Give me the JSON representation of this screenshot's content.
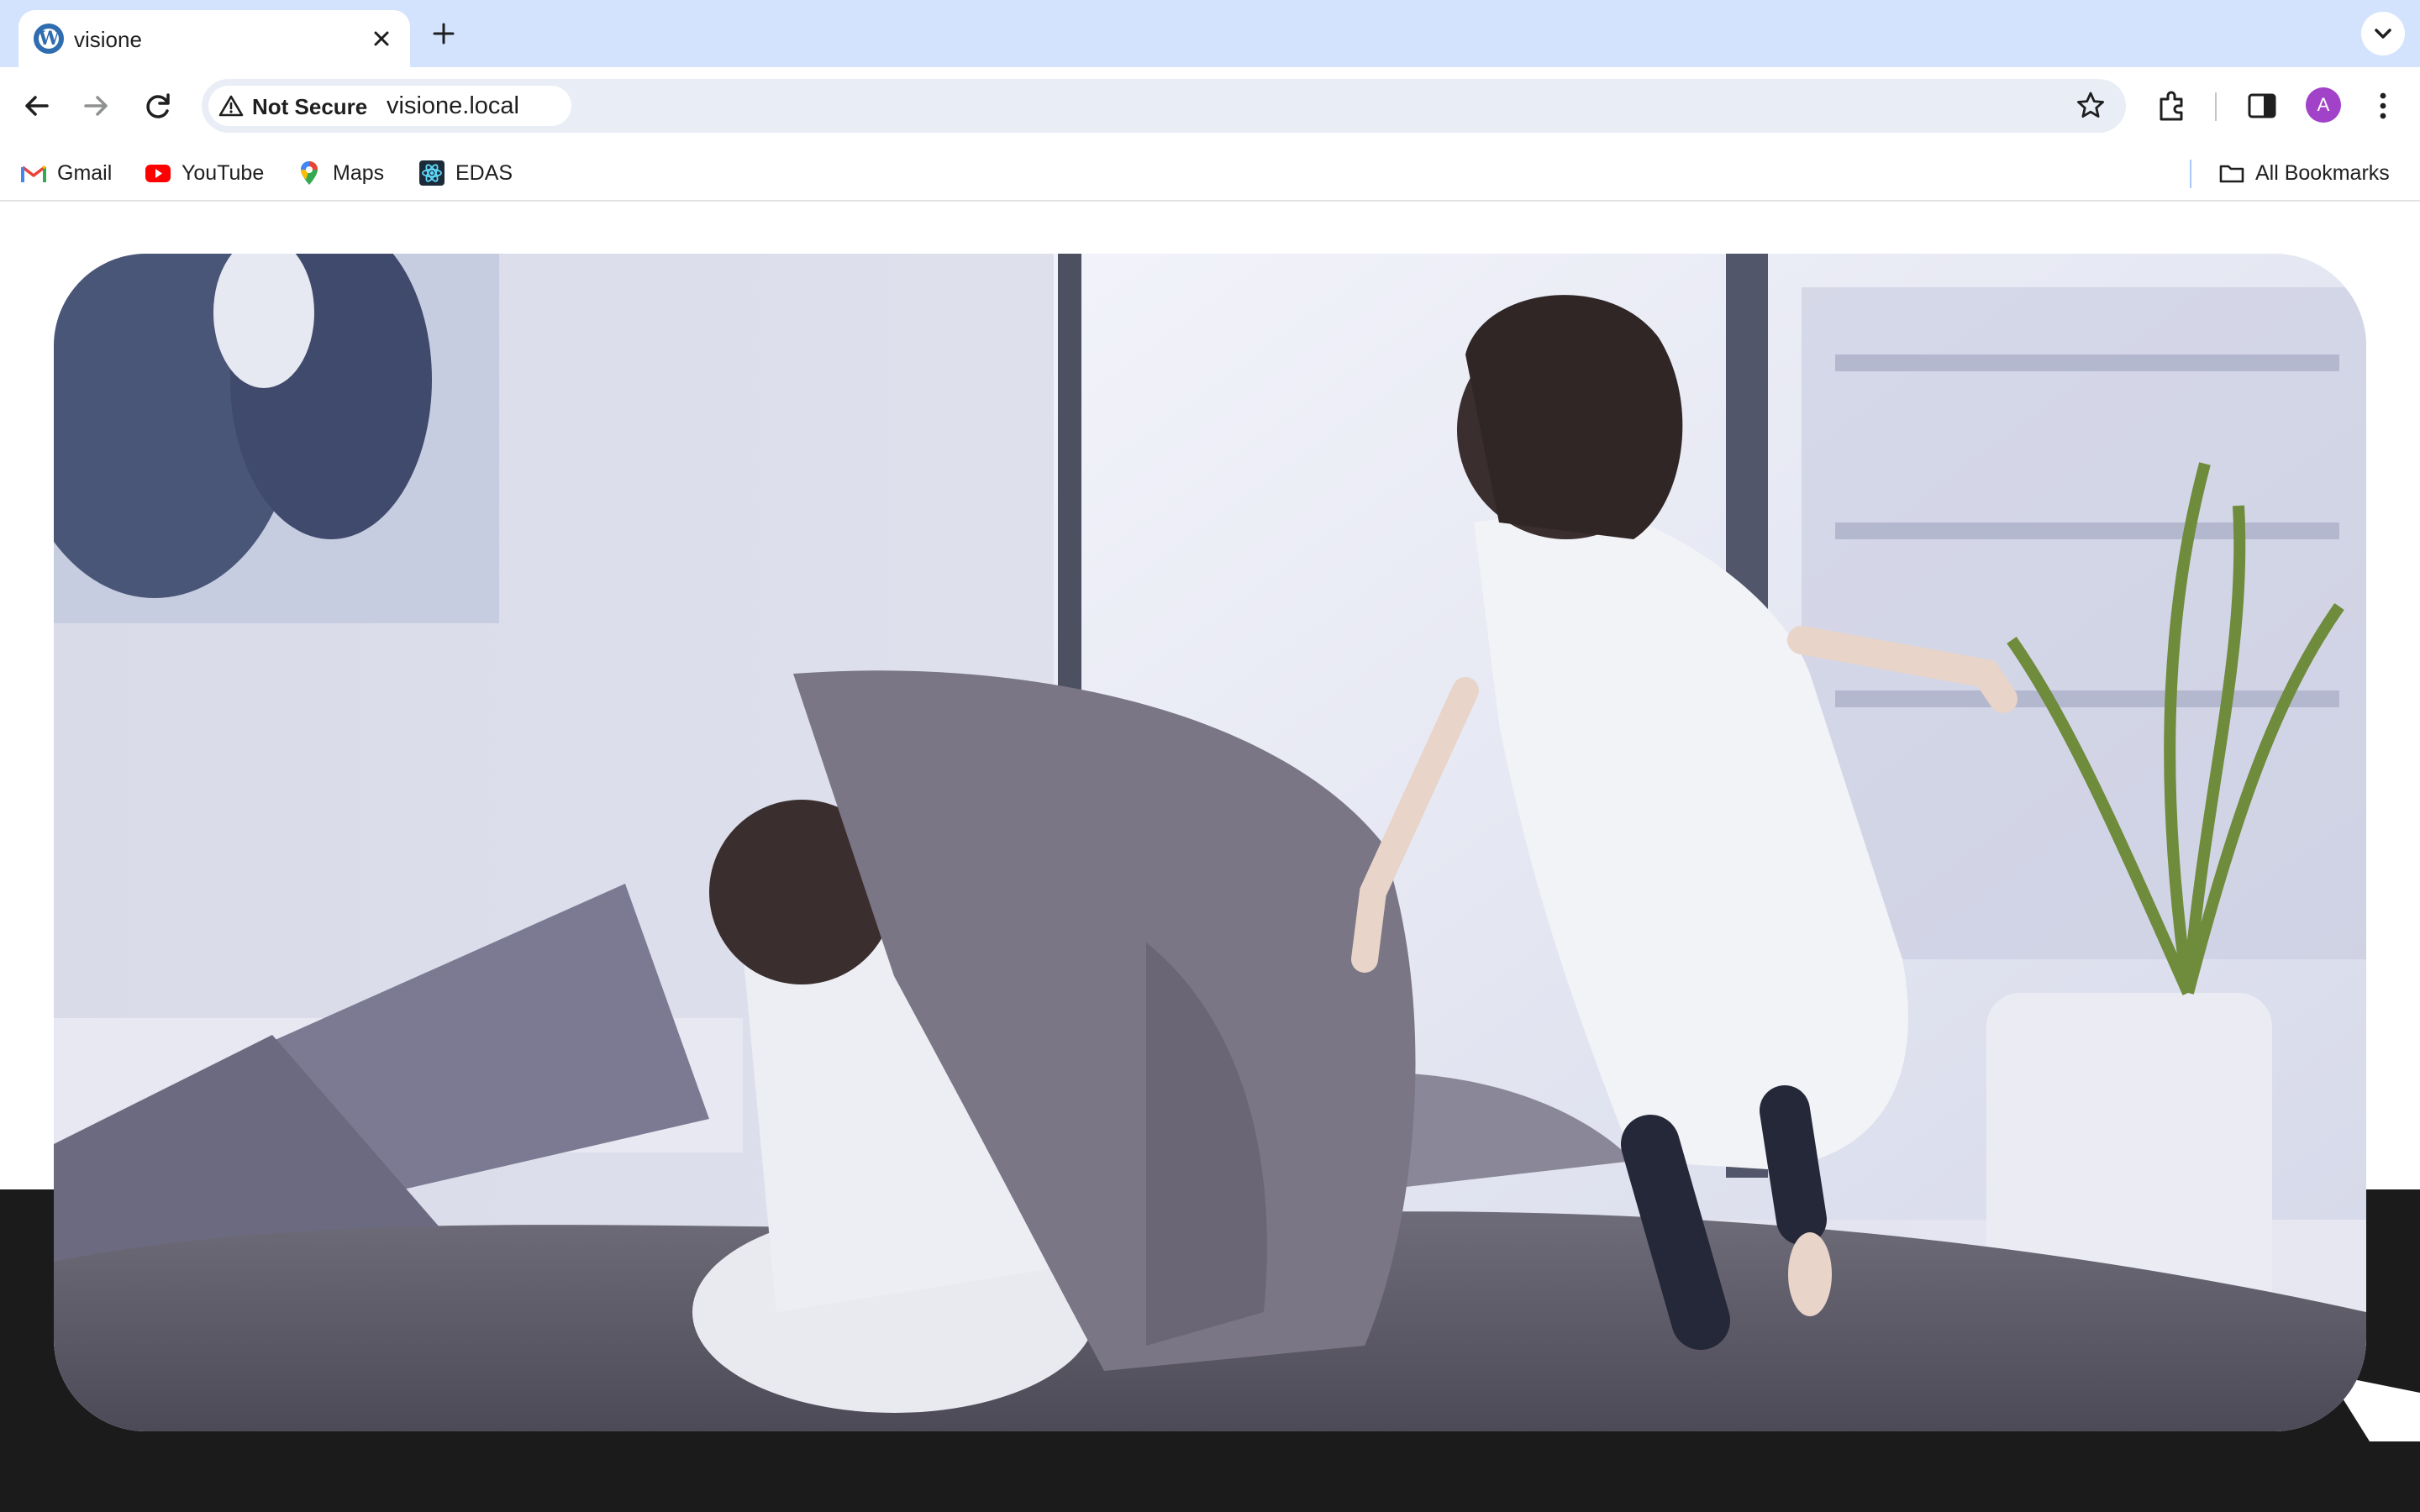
{
  "browser": {
    "tab": {
      "title": "visione",
      "favicon": "wordpress-icon"
    },
    "address_bar": {
      "security_label": "Not Secure",
      "url": "visione.local"
    },
    "profile_initial": "A",
    "bookmarks": [
      {
        "label": "Gmail",
        "icon": "gmail-icon"
      },
      {
        "label": "YouTube",
        "icon": "youtube-icon"
      },
      {
        "label": "Maps",
        "icon": "maps-icon"
      },
      {
        "label": "EDAS",
        "icon": "edas-icon"
      }
    ],
    "all_bookmarks_label": "All Bookmarks"
  },
  "colors": {
    "tabstrip": "#d3e3fd",
    "omnibox": "#e9eef6",
    "avatar": "#a142c8",
    "page_dark_band": "#1b1b1b"
  }
}
